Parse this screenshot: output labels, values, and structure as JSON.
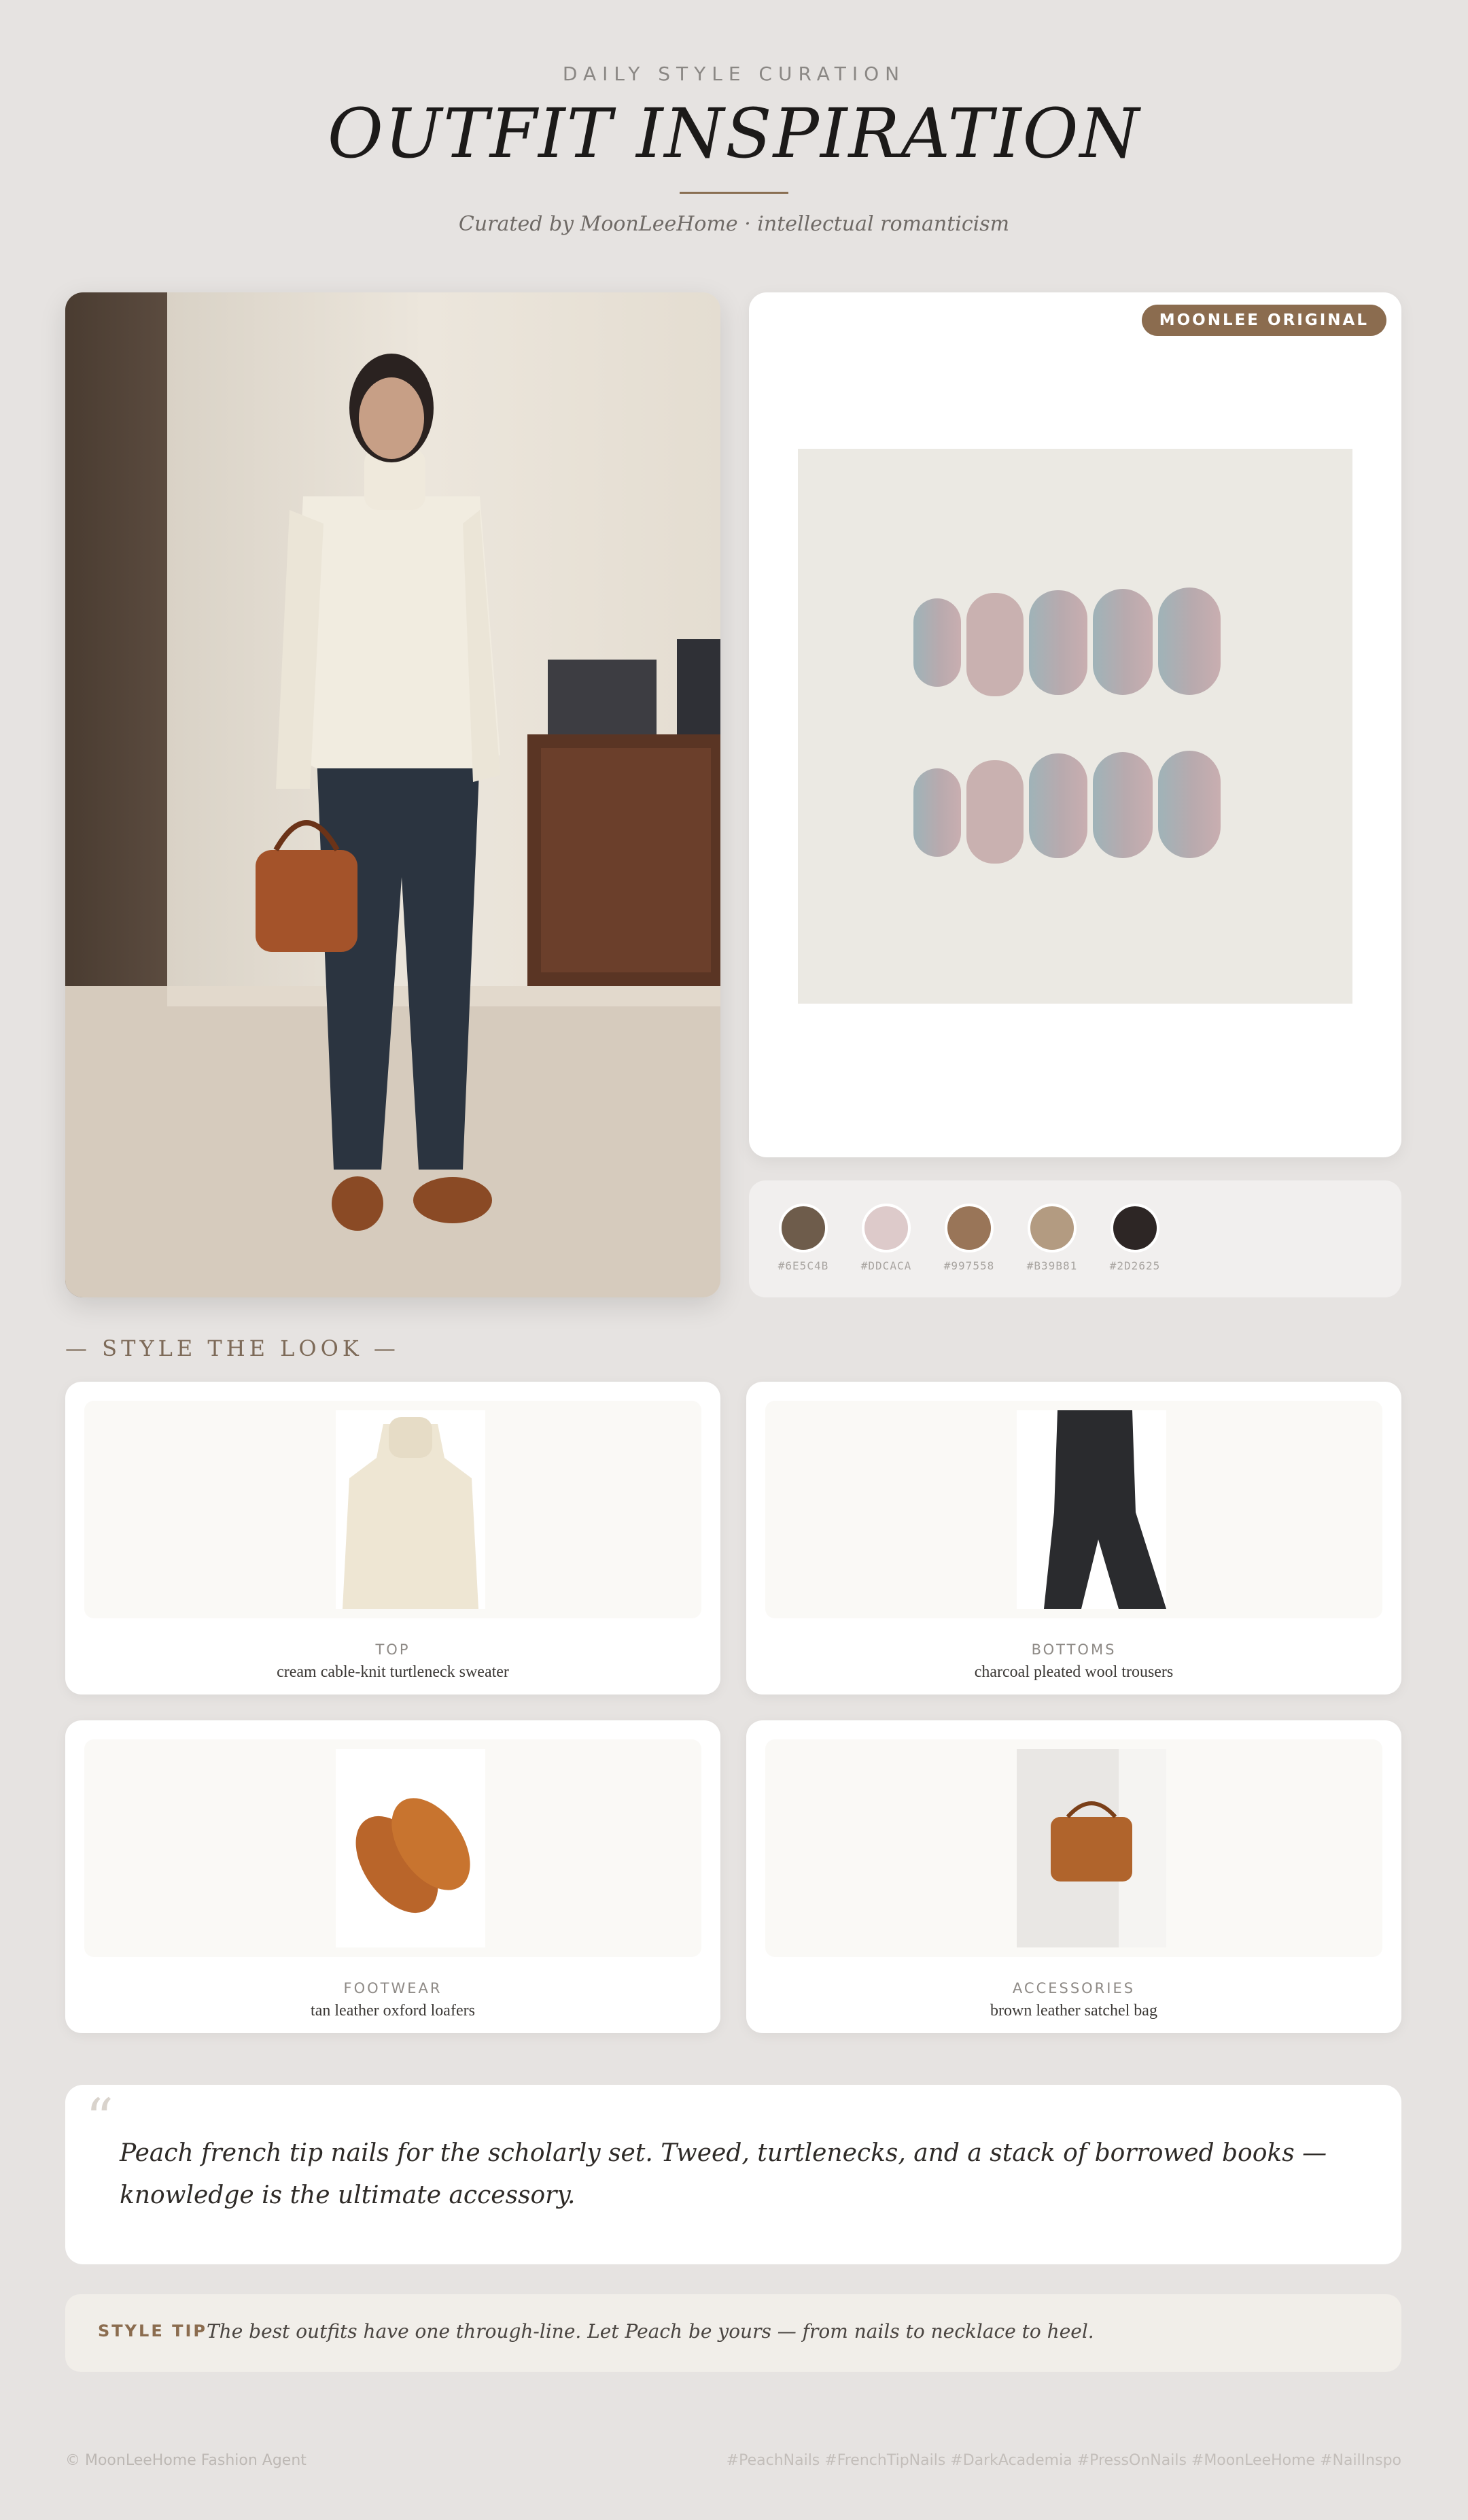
{
  "header": {
    "kicker": "DAILY STYLE CURATION",
    "title": "OUTFIT INSPIRATION",
    "subtitle": "Curated by MoonLeeHome · intellectual romanticism"
  },
  "nail_card": {
    "badge": "MOONLEE ORIGINAL"
  },
  "palette": {
    "swatches": [
      {
        "hex": "#6E5C4B",
        "label": "#6E5C4B"
      },
      {
        "hex": "#DDCACA",
        "label": "#DDCACA"
      },
      {
        "hex": "#997558",
        "label": "#997558"
      },
      {
        "hex": "#B39B81",
        "label": "#B39B81"
      },
      {
        "hex": "#2D2625",
        "label": "#2D2625"
      }
    ]
  },
  "section": {
    "label": "— STYLE THE LOOK —"
  },
  "items": [
    {
      "category": "TOP",
      "description": "cream cable-knit turtleneck sweater",
      "icon": "sweater-image"
    },
    {
      "category": "BOTTOMS",
      "description": "charcoal pleated wool trousers",
      "icon": "trousers-image"
    },
    {
      "category": "FOOTWEAR",
      "description": "tan leather oxford loafers",
      "icon": "loafers-image"
    },
    {
      "category": "ACCESSORIES",
      "description": "brown leather satchel bag",
      "icon": "satchel-image"
    }
  ],
  "quote": {
    "mark": "“",
    "text": "Peach french tip nails for the scholarly set. Tweed, turtlenecks, and a stack of borrowed books — knowledge is the ultimate accessory."
  },
  "tip": {
    "label": "STYLE TIP",
    "text": "The best outfits have one through-line. Let Peach be yours — from nails to necklace to heel."
  },
  "footer": {
    "left": "© MoonLeeHome Fashion Agent",
    "right": "#PeachNails #FrenchTipNails #DarkAcademia #PressOnNails #MoonLeeHome #NailInspo"
  },
  "colors": {
    "accent": "#8B6C4F",
    "background": "#E6E3E1"
  }
}
